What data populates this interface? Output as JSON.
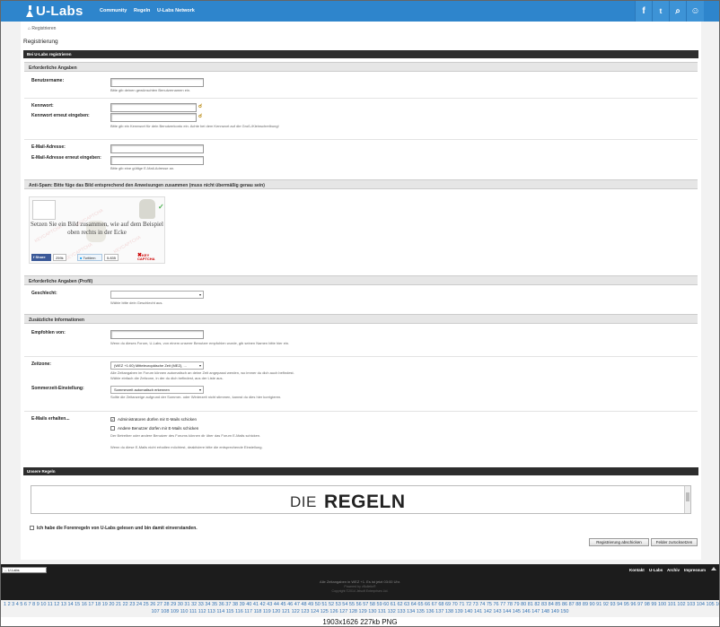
{
  "header": {
    "logo": "U-Labs",
    "nav": [
      "Community",
      "Regeln",
      "U-Labs Network"
    ],
    "icons": {
      "facebook": "f",
      "twitter": "t",
      "search": "⌕",
      "user": "☺"
    }
  },
  "breadcrumb": "Registrieren",
  "page_title": "Registrierung",
  "register_section": {
    "title": "Bei U-Labs registrieren",
    "required_title": "Erforderliche Angaben",
    "username_label": "Benutzername:",
    "username_hint": "Bitte gib deinen gewünschten Benutzernamen ein.",
    "password_label": "Kennwort:",
    "password_confirm_label": "Kennwort erneut eingeben:",
    "password_hint": "Bitte gib ein Kennwort für dein Benutzerkonto ein. Achte bei dem Kennwort auf die Groß-/Kleinschreibung!",
    "email_label": "E-Mail-Adresse:",
    "email_confirm_label": "E-Mail-Adresse erneut eingeben:",
    "email_hint": "Bitte gib eine gültige E-Mail-Adresse an."
  },
  "antispam": {
    "title": "Anti-Spam: Bitte füge das Bild entsprechend den Anweisungen zusammen (muss nicht übermäßig genau sein)",
    "captcha_text": "Setzen Sie ein Bild zusammen, wie auf dem Beispiel oben rechts in der Ecke",
    "watermark": "KEYCAPTCHA",
    "fb_label": "Share",
    "fb_count": "259k",
    "tw_label": "Twittern",
    "tw_count": "5.835",
    "brand": "KEY CAPTCHA"
  },
  "profile": {
    "title": "Erforderliche Angaben (Profil)",
    "gender_label": "Geschlecht:",
    "gender_hint": "Wähle bitte dein Geschlecht aus."
  },
  "additional": {
    "title": "Zusätzliche Informationen",
    "referrer_label": "Empfohlen von:",
    "referrer_hint": "Wenn du dieses Forum, U-Labs, von einem unserer Benutzer empfohlen wurde, gib seinen Namen bitte hier ein.",
    "tz_label": "Zeitzone:",
    "tz_value": "(WEZ +1:00) Mitteleuropäische Zeit (MEZ), ...",
    "tz_hint": "Alle Zeitangaben im Forum können automatisch an deine Zeit angepasst werden, wo immer du dich auch befindest. Wähle einfach die Zeitzone, in der du dich befindest, aus der Liste aus.",
    "dst_label": "Sommerzeit-Einstellung:",
    "dst_value": "Sommerzeit automatisch erkennen",
    "dst_hint": "Sollte die Zeitanzeige aufgrund der Sommer- oder Winterzeit nicht stimmen, kannst du dies hier korrigieren.",
    "email_recv_label": "E-Mails erhalten...",
    "email_admin": "Administratoren dürfen mir E-Mails schicken",
    "email_users": "Andere Benutzer dürfen mir E-Mails schicken",
    "email_users_hint": "Der Betreiber oder andere Benutzer des Forums können dir über das Forum E-Mails schicken.",
    "email_note": "Wenn du diese E-Mails nicht erhalten möchtest, deaktiviere bitte die entsprechende Einstellung."
  },
  "rules": {
    "title": "Unsere Regeln",
    "die": "DIE",
    "regeln": "REGELN",
    "agree": "Ich habe die Forenregeln von U-Labs gelesen und bin damit einverstanden."
  },
  "buttons": {
    "submit": "Registrierung abschicken",
    "reset": "Felder zurücksetzen"
  },
  "footer": {
    "style_select": "-- U-Labs",
    "links": [
      "Kontakt",
      "U-Labs",
      "Archiv",
      "Impressum"
    ],
    "timezone": "Alle Zeitangaben in WEZ +1. Es ist jetzt 03:00 Uhr.",
    "powered": "Powered by vBulletin®",
    "copyright": "Copyright ©2014 Jelsoft Enterprises Ltd."
  },
  "pagination": {
    "row1": "1 2 3 4 5 6 7 8 9 10 11 12 13 14 15 16 17 18 19 20 21 22 23 24 25 26 27 28 29 30 31 32 33 34 35 36 37 38 39 40 41 42 43 44 45 46 47 48 49 50 51 52 53 54 55 56 57 58 59 60 61 62 63 64 65 66 67 68 69 70 71 72 73 74 75 76 77 78 79 80 81 82 83 84 85 86 87 88 89 90 91 92 93 94 95 96 97 98 99 100 101 102 103 104 105 106",
    "row2": "107 108 109 110 111 112 113 114 115 116 117 118 119 120 121 122 123 124 125 126 127 128 129 130 131 132 133 134 135 136 137 138 139 140 141 142 143 144 145 146 147 148 149 150"
  },
  "caption": "1903x1626 227kb PNG",
  "colors": {
    "brand": "#2e85cc",
    "dark": "#2d2d2d",
    "link": "#2e6fb2"
  }
}
